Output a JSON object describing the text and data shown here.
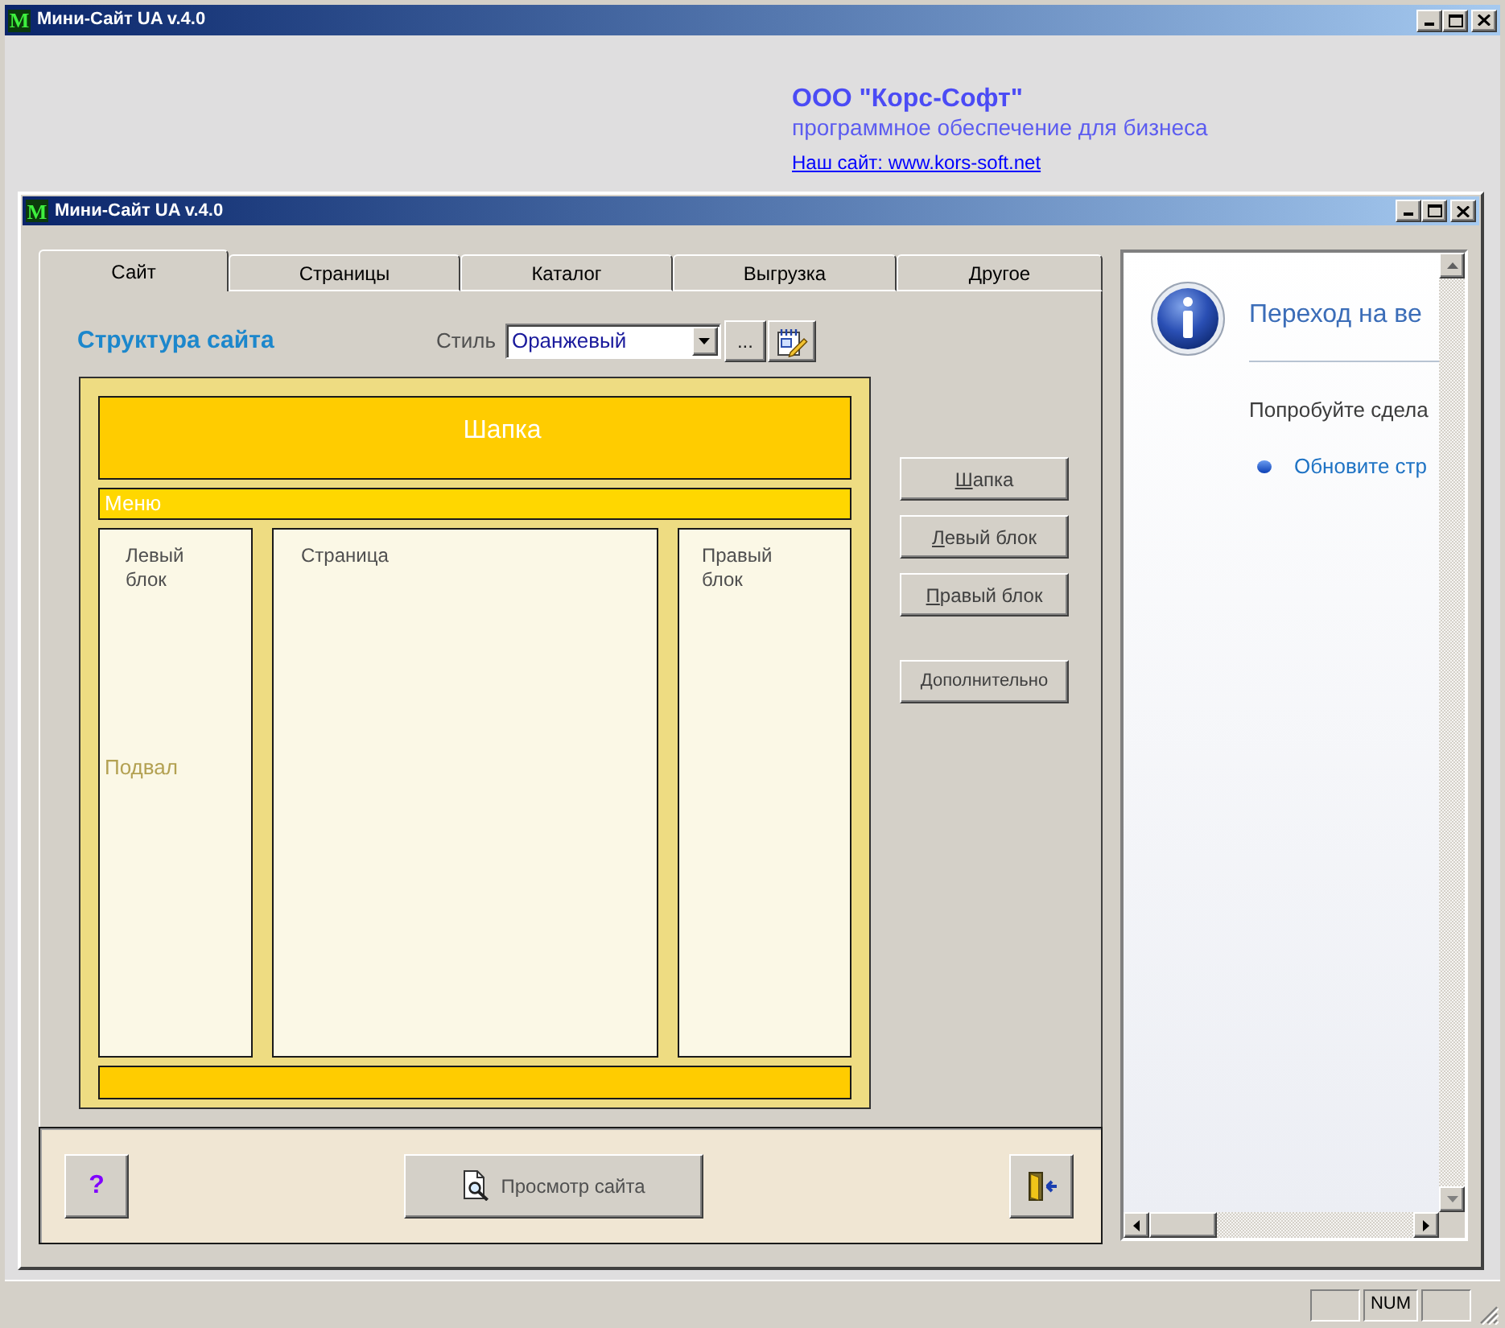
{
  "main_window": {
    "logo": "M",
    "title": "Мини-Сайт UA v.4.0"
  },
  "company_banner": {
    "name": "ООО \"Корс-Софт\"",
    "tagline": "программное обеспечение для бизнеса",
    "website_link": "Наш сайт: www.kors-soft.net"
  },
  "child_window": {
    "logo": "M",
    "title": "Мини-Сайт UA v.4.0"
  },
  "tabs": [
    {
      "label": "Сайт",
      "selected": true
    },
    {
      "label": "Страницы",
      "selected": false
    },
    {
      "label": "Каталог",
      "selected": false
    },
    {
      "label": "Выгрузка",
      "selected": false
    },
    {
      "label": "Другое",
      "selected": false
    }
  ],
  "site_structure": {
    "title": "Структура сайта",
    "style_label": "Стиль",
    "style_value": "Оранжевый",
    "browse_button": "...",
    "layout_blocks": [
      {
        "kind": "header",
        "label": "Шапка"
      },
      {
        "kind": "menu",
        "label": "Меню"
      },
      {
        "kind": "left",
        "label": "Левый блок"
      },
      {
        "kind": "page",
        "label": "Страница"
      },
      {
        "kind": "right",
        "label": "Правый блок"
      },
      {
        "kind": "footer",
        "label": "Подвал"
      }
    ],
    "block_buttons": [
      {
        "kind": "block",
        "label": "Шапка"
      },
      {
        "kind": "block",
        "label": "Левый блок"
      },
      {
        "kind": "block",
        "label": "Правый блок"
      },
      {
        "kind": "extra",
        "label": "Дополнительно"
      }
    ]
  },
  "bottom_bar": {
    "help_button": "?",
    "preview_button": "Просмотр сайта"
  },
  "browser_panel": {
    "heading": "Переход на ве",
    "message": "Попробуйте сдела",
    "bullets": [
      "Обновите стр"
    ]
  },
  "status_bar": {
    "num_indicator": "NUM"
  }
}
